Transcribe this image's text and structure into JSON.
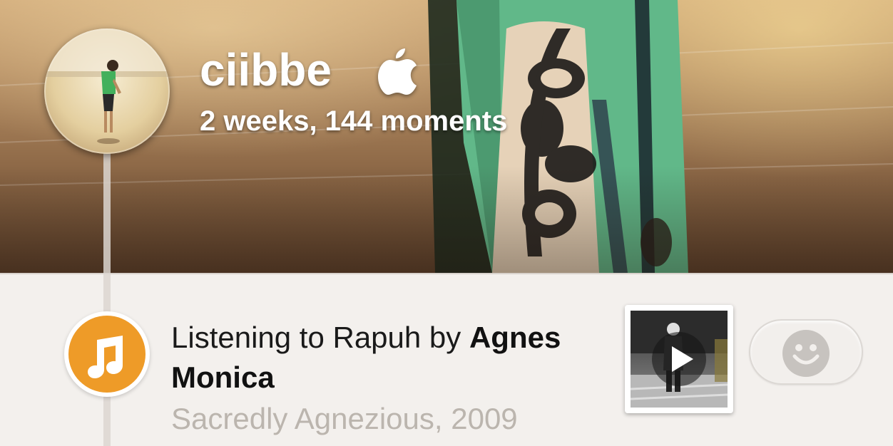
{
  "profile": {
    "name": "ciibbe",
    "stats": "2 weeks, 144 moments",
    "badge_icon": "apple-icon"
  },
  "moment": {
    "type_icon": "music-note-icon",
    "accent_color": "#ee9b28",
    "text_prefix": "Listening to Rapuh by ",
    "artist": "Agnes Monica",
    "album": "Sacredly Agnezious, 2009",
    "thumbnail_icon": "play-icon",
    "action_icon": "smile-icon"
  }
}
